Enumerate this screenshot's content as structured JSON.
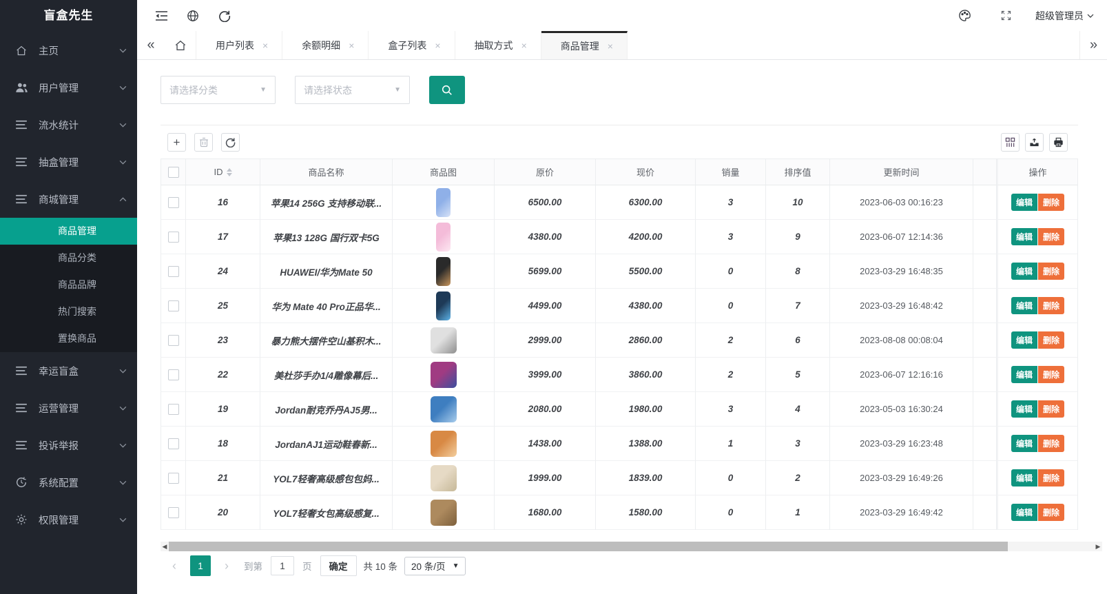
{
  "colors": {
    "accent": "#0f947f",
    "accent_sidebar": "#07a08e",
    "danger": "#ee6f3a"
  },
  "sidebar": {
    "title": "盲盒先生",
    "items": [
      {
        "label": "主页",
        "icon": "home-icon"
      },
      {
        "label": "用户管理",
        "icon": "users-icon"
      },
      {
        "label": "流水统计",
        "icon": "list-icon"
      },
      {
        "label": "抽盒管理",
        "icon": "list-icon"
      },
      {
        "label": "商城管理",
        "icon": "list-icon",
        "expanded": true,
        "children": [
          {
            "label": "商品管理",
            "active": true
          },
          {
            "label": "商品分类"
          },
          {
            "label": "商品品牌"
          },
          {
            "label": "热门搜索"
          },
          {
            "label": "置换商品"
          }
        ]
      },
      {
        "label": "幸运盲盒",
        "icon": "list-icon"
      },
      {
        "label": "运营管理",
        "icon": "list-icon"
      },
      {
        "label": "投诉举报",
        "icon": "list-icon"
      },
      {
        "label": "系统配置",
        "icon": "history-icon"
      },
      {
        "label": "权限管理",
        "icon": "gear-icon"
      }
    ]
  },
  "topbar": {
    "user": "超级管理员"
  },
  "tabbar": {
    "scroll_left": "«",
    "scroll_right": "»",
    "close_glyph": "×",
    "tabs": [
      {
        "label": "用户列表"
      },
      {
        "label": "余额明细"
      },
      {
        "label": "盒子列表"
      },
      {
        "label": "抽取方式"
      },
      {
        "label": "商品管理",
        "active": true
      }
    ]
  },
  "filters": {
    "category_placeholder": "请选择分类",
    "status_placeholder": "请选择状态"
  },
  "table": {
    "headers": {
      "id": "ID",
      "name": "商品名称",
      "image": "商品图",
      "original_price": "原价",
      "price": "现价",
      "sales": "销量",
      "sort": "排序值",
      "updated": "更新时间",
      "actions": "操作"
    },
    "actions": {
      "edit": "编辑",
      "delete": "删除"
    },
    "rows": [
      {
        "id": "16",
        "name": "苹果14 256G 支持移动联...",
        "original_price": "6500.00",
        "price": "6300.00",
        "sales": "3",
        "sort": "10",
        "updated": "2023-06-03 00:16:23",
        "image": {
          "shape": "phone",
          "c1": "#8fb0e8",
          "c2": "#d6e2f7"
        }
      },
      {
        "id": "17",
        "name": "苹果13 128G 国行双卡5G",
        "original_price": "4380.00",
        "price": "4200.00",
        "sales": "3",
        "sort": "9",
        "updated": "2023-06-07 12:14:36",
        "image": {
          "shape": "phone",
          "c1": "#f4bcd9",
          "c2": "#fde8f2"
        }
      },
      {
        "id": "24",
        "name": "HUAWEI/华为Mate 50",
        "original_price": "5699.00",
        "price": "5500.00",
        "sales": "0",
        "sort": "8",
        "updated": "2023-03-29 16:48:35",
        "image": {
          "shape": "phone",
          "c1": "#2a2a2a",
          "c2": "#c9965c"
        }
      },
      {
        "id": "25",
        "name": "华为 Mate 40 Pro正品华...",
        "original_price": "4499.00",
        "price": "4380.00",
        "sales": "0",
        "sort": "7",
        "updated": "2023-03-29 16:48:42",
        "image": {
          "shape": "phone",
          "c1": "#1e3a57",
          "c2": "#5db3e8"
        }
      },
      {
        "id": "23",
        "name": "暴力熊大摆件空山基积木...",
        "original_price": "2999.00",
        "price": "2860.00",
        "sales": "2",
        "sort": "6",
        "updated": "2023-08-08 00:08:04",
        "image": {
          "shape": "figure",
          "c1": "#e0e0e0",
          "c2": "#8f8f8f"
        }
      },
      {
        "id": "22",
        "name": "美杜莎手办1/4雕像幕后...",
        "original_price": "3999.00",
        "price": "3860.00",
        "sales": "2",
        "sort": "5",
        "updated": "2023-06-07 12:16:16",
        "image": {
          "shape": "figure",
          "c1": "#a03b82",
          "c2": "#3b4f9e"
        }
      },
      {
        "id": "19",
        "name": "Jordan耐克乔丹AJ5男...",
        "original_price": "2080.00",
        "price": "1980.00",
        "sales": "3",
        "sort": "4",
        "updated": "2023-05-03 16:30:24",
        "image": {
          "shape": "shoe",
          "c1": "#3e7ec0",
          "c2": "#a9cdec"
        }
      },
      {
        "id": "18",
        "name": "JordanAJ1运动鞋春新...",
        "original_price": "1438.00",
        "price": "1388.00",
        "sales": "1",
        "sort": "3",
        "updated": "2023-03-29 16:23:48",
        "image": {
          "shape": "shoe",
          "c1": "#d88944",
          "c2": "#f3cf9f"
        }
      },
      {
        "id": "21",
        "name": "YOL7轻奢高级感包包妈...",
        "original_price": "1999.00",
        "price": "1839.00",
        "sales": "0",
        "sort": "2",
        "updated": "2023-03-29 16:49:26",
        "image": {
          "shape": "bag",
          "c1": "#e6dac5",
          "c2": "#c6b898"
        }
      },
      {
        "id": "20",
        "name": "YOL7轻奢女包高级感复...",
        "original_price": "1680.00",
        "price": "1580.00",
        "sales": "0",
        "sort": "1",
        "updated": "2023-03-29 16:49:42",
        "image": {
          "shape": "bag",
          "c1": "#ad8a5e",
          "c2": "#7d603c"
        }
      }
    ]
  },
  "pagination": {
    "prev": "‹",
    "next": "›",
    "current_page": "1",
    "goto_prefix": "到第",
    "goto_value": "1",
    "goto_suffix": "页",
    "confirm": "确定",
    "total": "共 10 条",
    "page_size": "20 条/页"
  }
}
